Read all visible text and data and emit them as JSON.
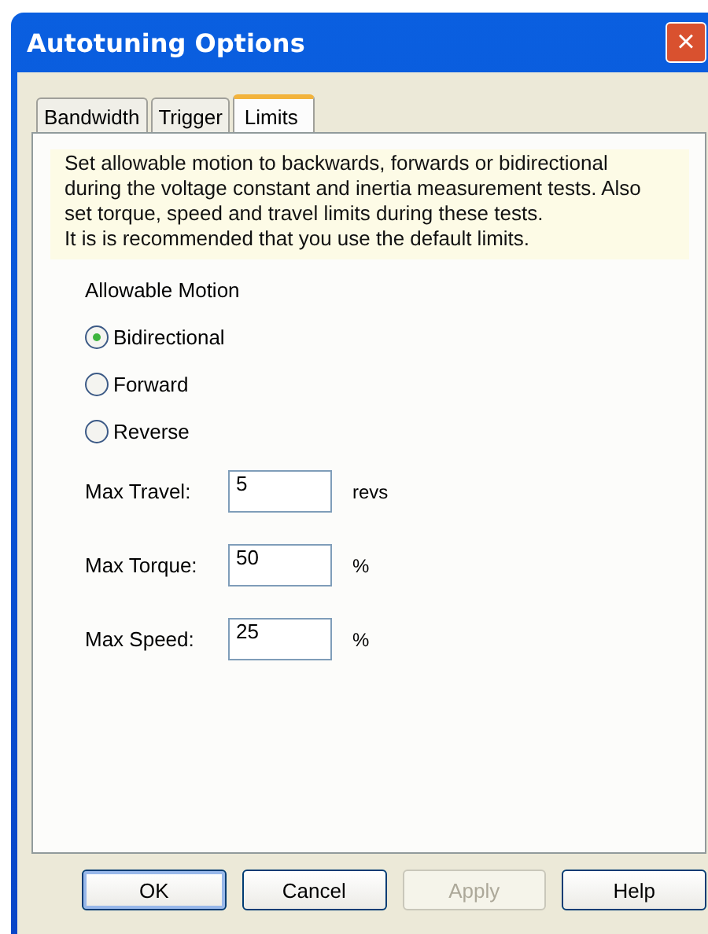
{
  "window": {
    "title": "Autotuning Options",
    "close": "×"
  },
  "tabs": [
    {
      "label": "Bandwidth",
      "selected": false
    },
    {
      "label": "Trigger",
      "selected": false
    },
    {
      "label": "Limits",
      "selected": true
    }
  ],
  "description": [
    "Set allowable motion to backwards, forwards or bidirectional",
    "during the voltage constant and inertia measurement tests. Also",
    "set torque, speed and travel limits during these tests.",
    "It is is recommended that you use the default limits."
  ],
  "motion": {
    "label": "Allowable Motion",
    "options": [
      {
        "label": "Bidirectional",
        "selected": true
      },
      {
        "label": "Forward",
        "selected": false
      },
      {
        "label": "Reverse",
        "selected": false
      }
    ]
  },
  "limits": [
    {
      "label": "Max Travel:",
      "value": "5",
      "unit": "revs"
    },
    {
      "label": "Max Torque:",
      "value": "50",
      "unit": "%"
    },
    {
      "label": "Max Speed:",
      "value": "25",
      "unit": "%"
    }
  ],
  "buttons": [
    {
      "label": "OK",
      "disabled": false,
      "default": true
    },
    {
      "label": "Cancel",
      "disabled": false,
      "default": false
    },
    {
      "label": "Apply",
      "disabled": true,
      "default": false
    },
    {
      "label": "Help",
      "disabled": false,
      "default": false
    }
  ]
}
